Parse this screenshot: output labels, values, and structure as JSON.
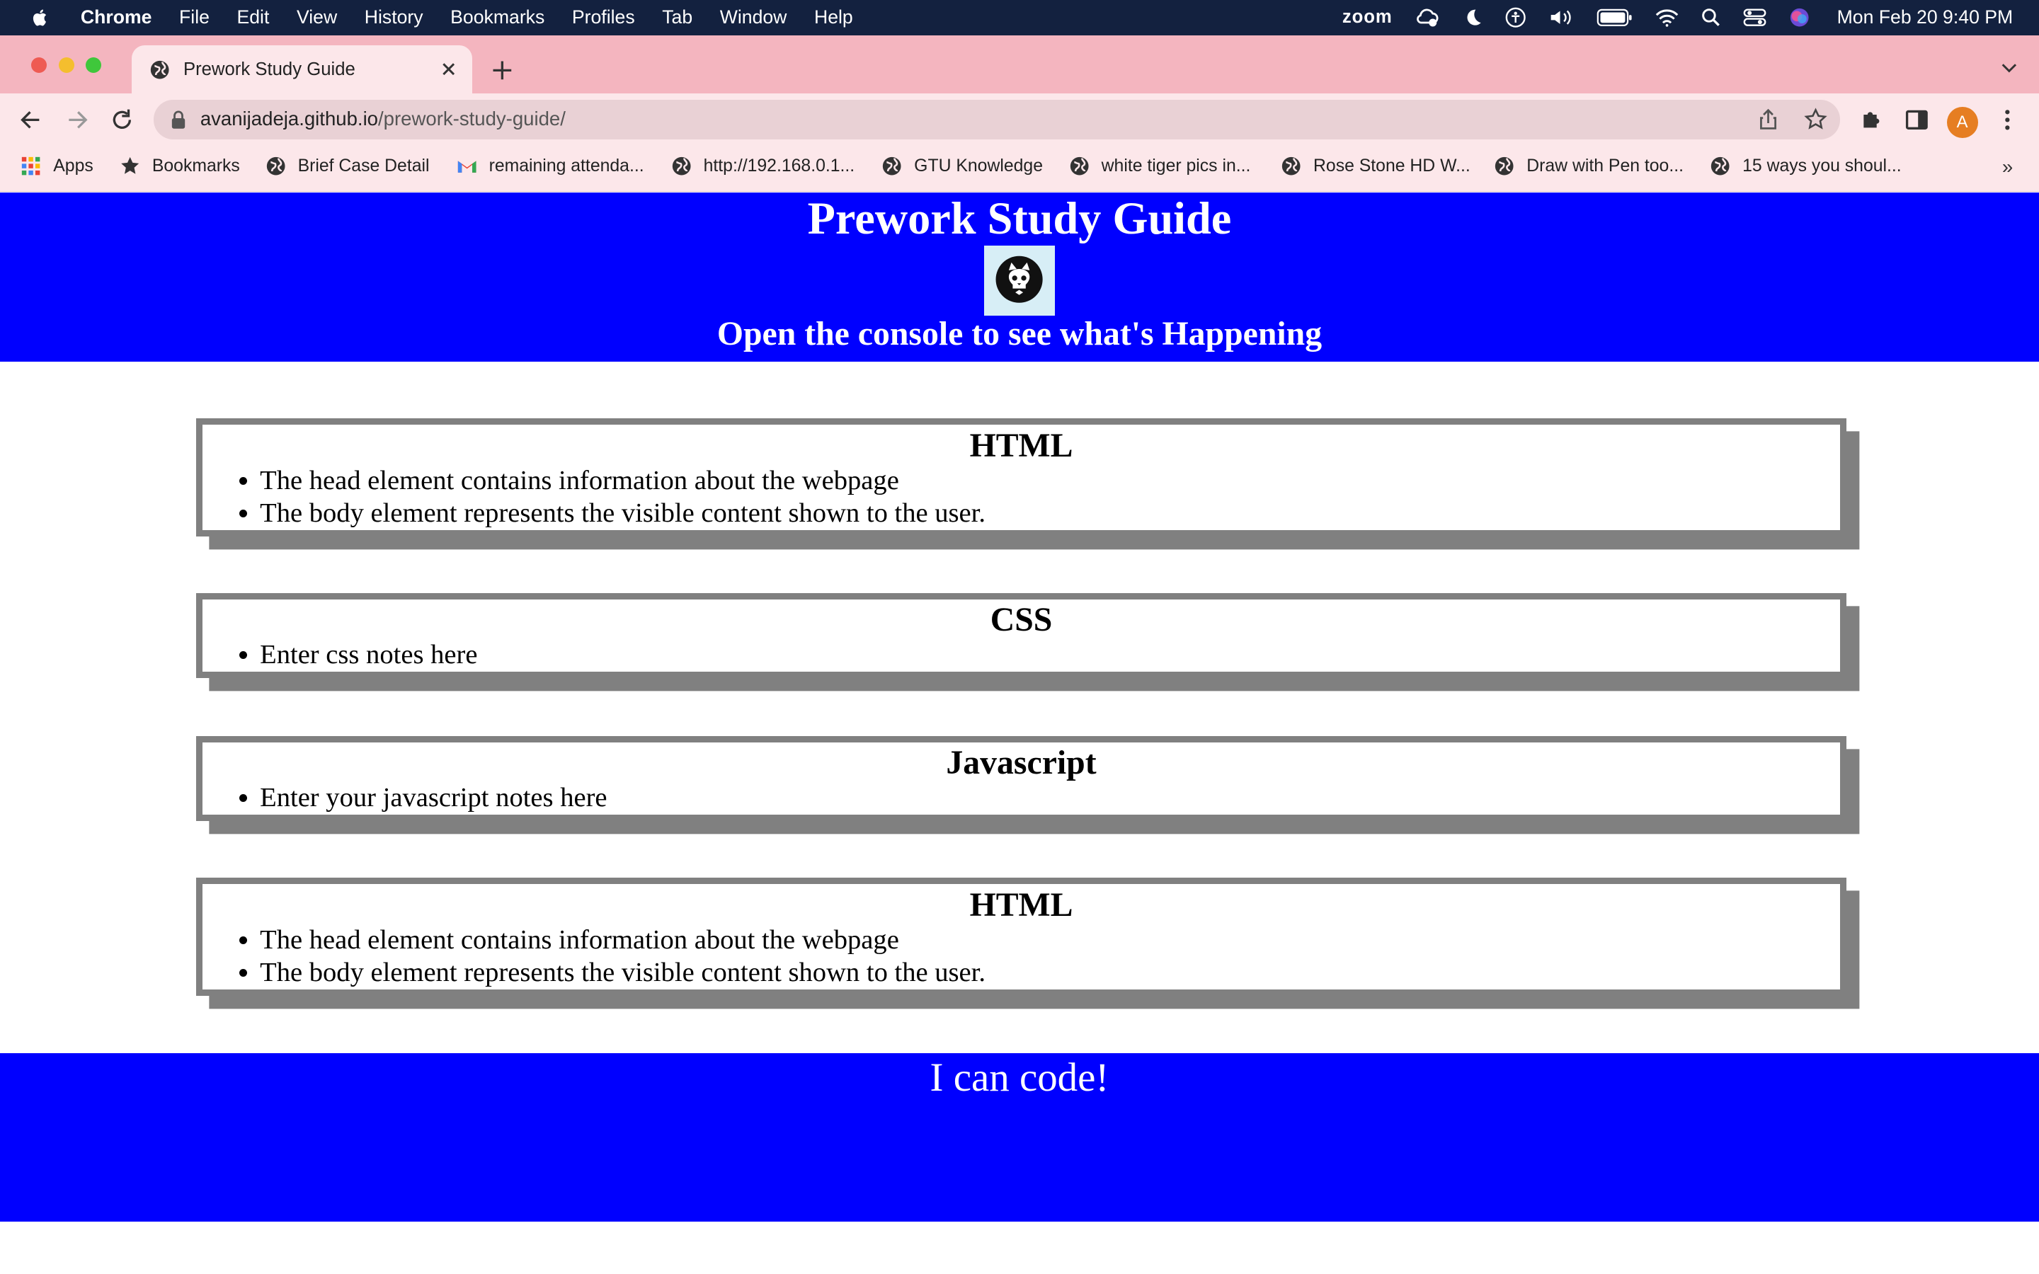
{
  "menubar": {
    "items": [
      "Chrome",
      "File",
      "Edit",
      "View",
      "History",
      "Bookmarks",
      "Profiles",
      "Tab",
      "Window",
      "Help"
    ],
    "zoom_label": "zoom",
    "clock": "Mon Feb 20  9:40 PM"
  },
  "browser": {
    "tab_title": "Prework Study Guide",
    "url_host": "avanijadeja.github.io",
    "url_path": "/prework-study-guide/",
    "avatar_letter": "A",
    "bookmarks": [
      "Apps",
      "Bookmarks",
      "Brief Case Detail",
      "remaining attenda...",
      "http://192.168.0.1...",
      "GTU Knowledge",
      "white tiger pics in...",
      "Rose Stone HD W...",
      "Draw with Pen too...",
      "15 ways you shoul..."
    ],
    "bookmarks_more": "»"
  },
  "page": {
    "title": "Prework Study Guide",
    "subtitle": "Open the console to see what's Happening",
    "sections": [
      {
        "heading": "HTML",
        "notes": [
          "The head element contains information about the webpage",
          "The body element represents the visible content shown to the user."
        ]
      },
      {
        "heading": "CSS",
        "notes": [
          "Enter css notes here"
        ]
      },
      {
        "heading": "Javascript",
        "notes": [
          "Enter your javascript notes here"
        ]
      },
      {
        "heading": "HTML",
        "notes": [
          "The head element contains information about the webpage",
          "The body element represents the visible content shown to the user."
        ]
      }
    ],
    "footer": "I can code!"
  },
  "colors": {
    "header_bg": "#0000ff",
    "card_border": "#808080",
    "tabstrip_bg": "#f4b5bf",
    "toolbar_bg": "#fce7ea"
  }
}
